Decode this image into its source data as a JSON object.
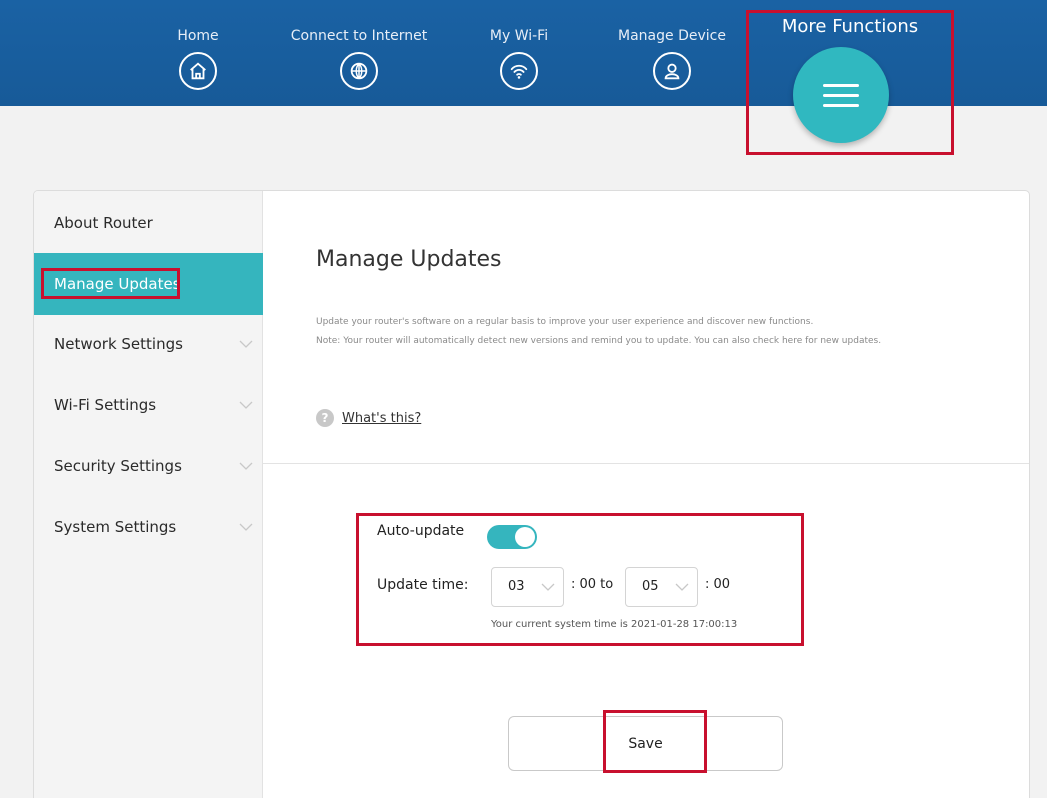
{
  "nav": {
    "items": [
      {
        "label": "Home",
        "icon": "home-icon"
      },
      {
        "label": "Connect to Internet",
        "icon": "globe-icon"
      },
      {
        "label": "My Wi-Fi",
        "icon": "wifi-icon"
      },
      {
        "label": "Manage Device",
        "icon": "user-icon"
      }
    ],
    "more_label": "More Functions",
    "more_icon": "menu-icon"
  },
  "sidebar": {
    "items": [
      {
        "label": "About Router",
        "expandable": false
      },
      {
        "label": "Manage Updates",
        "expandable": false,
        "active": true
      },
      {
        "label": "Network Settings",
        "expandable": true
      },
      {
        "label": "Wi-Fi Settings",
        "expandable": true
      },
      {
        "label": "Security Settings",
        "expandable": true
      },
      {
        "label": "System Settings",
        "expandable": true
      }
    ]
  },
  "main": {
    "title": "Manage Updates",
    "description_line1": "Update your router's software on a regular basis to improve your user experience and discover new functions.",
    "description_line2": "Note: Your router will automatically detect new versions and remind you to update. You can also check here for new updates.",
    "help_link": "What's this?",
    "auto_update_label": "Auto-update",
    "auto_update_enabled": true,
    "update_time_label": "Update time:",
    "start_hour": "03",
    "start_minute_text": ": 00 to",
    "end_hour": "05",
    "end_minute_text": ": 00",
    "system_time_text": "Your current system time is 2021-01-28 17:00:13",
    "save_label": "Save"
  },
  "colors": {
    "topbar": "#1a62a4",
    "accent": "#35b5be",
    "highlight": "#c8102e"
  }
}
